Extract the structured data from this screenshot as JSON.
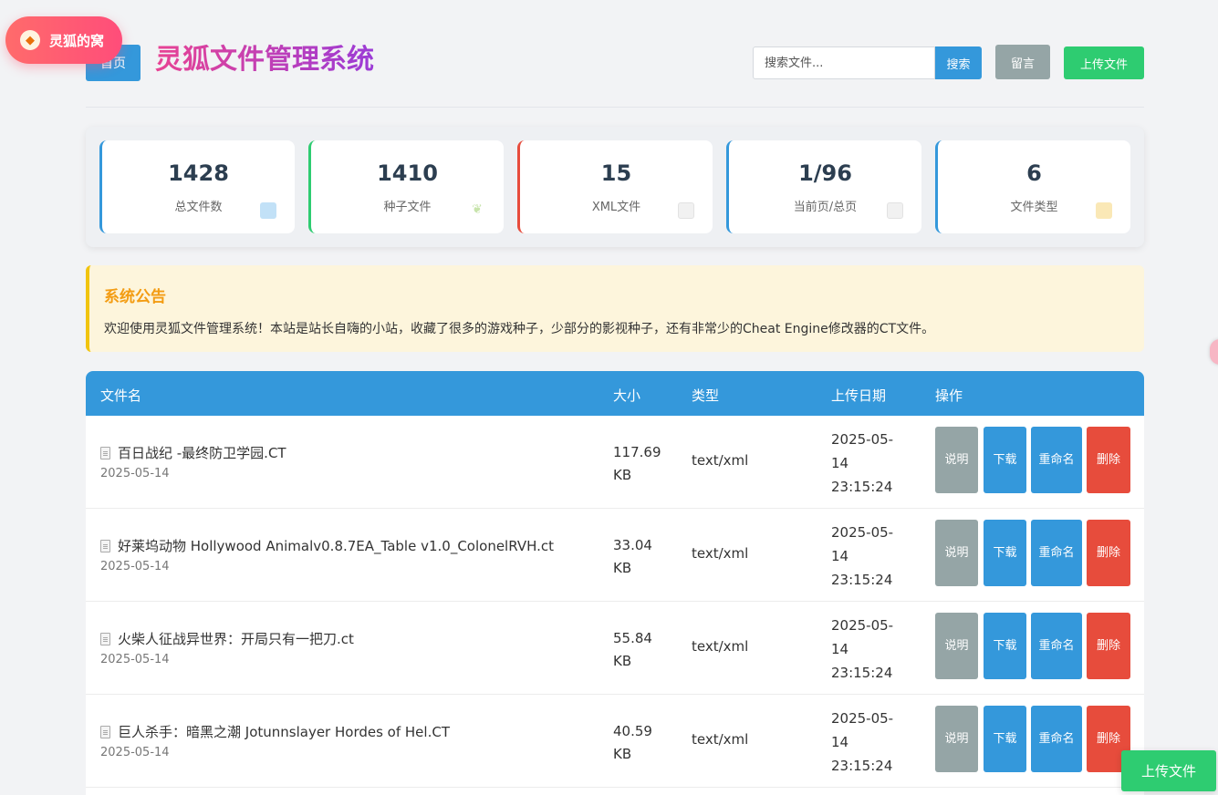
{
  "badge": {
    "label": "灵狐的窝",
    "icon": "fox-icon"
  },
  "header": {
    "home_label": "首页",
    "title": "灵狐文件管理系统",
    "search_placeholder": "搜索文件...",
    "search_label": "搜索",
    "message_label": "留言",
    "upload_label": "上传文件"
  },
  "stats": [
    {
      "value": "1428",
      "label": "总文件数",
      "icon": "refresh-icon",
      "color": "#3498db"
    },
    {
      "value": "1410",
      "label": "种子文件",
      "icon": "seedling-icon",
      "color": "#2ecc71"
    },
    {
      "value": "15",
      "label": "XML文件",
      "icon": "document-icon",
      "color": "#e74c3c"
    },
    {
      "value": "1/96",
      "label": "当前页/总页",
      "icon": "page-icon",
      "color": "#3498db"
    },
    {
      "value": "6",
      "label": "文件类型",
      "icon": "folder-icon",
      "color": "#3498db"
    }
  ],
  "notice": {
    "title": "系统公告",
    "text": "欢迎使用灵狐文件管理系统！本站是站长自嗨的小站，收藏了很多的游戏种子，少部分的影视种子，还有非常少的Cheat Engine修改器的CT文件。"
  },
  "table": {
    "headers": [
      "文件名",
      "大小",
      "类型",
      "上传日期",
      "操作"
    ],
    "actions": {
      "describe": "说明",
      "download": "下载",
      "rename": "重命名",
      "delete": "删除"
    },
    "rows": [
      {
        "name": "百日战纪 -最终防卫学园.CT",
        "date": "2025-05-14",
        "size": "117.69 KB",
        "type": "text/xml",
        "uploaded": "2025-05-14 23:15:24"
      },
      {
        "name": "好莱坞动物 Hollywood Animalv0.8.7EA_Table v1.0_ColonelRVH.ct",
        "date": "2025-05-14",
        "size": "33.04 KB",
        "type": "text/xml",
        "uploaded": "2025-05-14 23:15:24"
      },
      {
        "name": "火柴人征战异世界：开局只有一把刀.ct",
        "date": "2025-05-14",
        "size": "55.84 KB",
        "type": "text/xml",
        "uploaded": "2025-05-14 23:15:24"
      },
      {
        "name": "巨人杀手：暗黑之潮 Jotunnslayer Hordes of Hel.CT",
        "date": "2025-05-14",
        "size": "40.59 KB",
        "type": "text/xml",
        "uploaded": "2025-05-14 23:15:24"
      }
    ]
  },
  "float_upload_label": "上传文件"
}
